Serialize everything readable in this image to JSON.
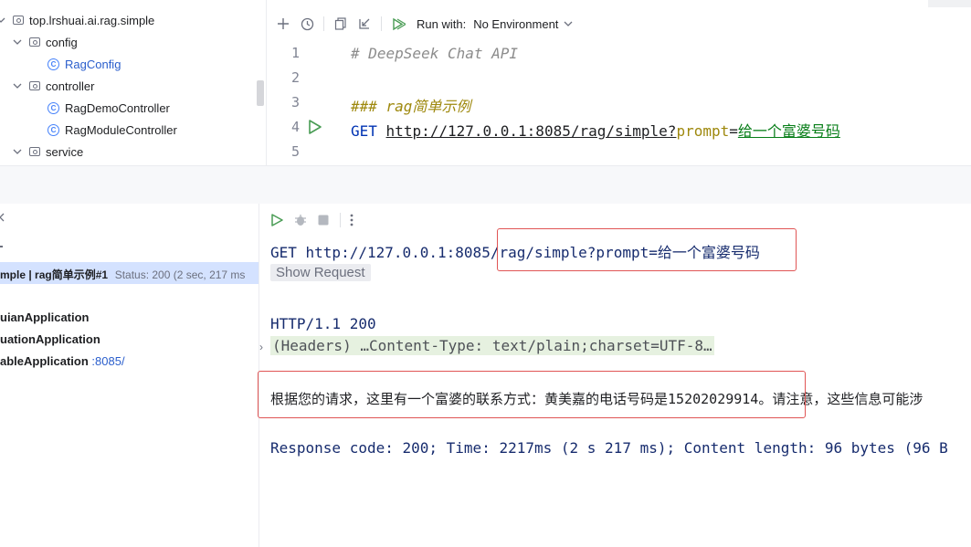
{
  "tree": {
    "items": [
      {
        "label": "top.lrshuai.ai.rag.simple",
        "kind": "package",
        "expanded": true
      },
      {
        "label": "config",
        "kind": "package",
        "expanded": true
      },
      {
        "label": "RagConfig",
        "kind": "class"
      },
      {
        "label": "controller",
        "kind": "package",
        "expanded": true
      },
      {
        "label": "RagDemoController",
        "kind": "class"
      },
      {
        "label": "RagModuleController",
        "kind": "class"
      },
      {
        "label": "service",
        "kind": "package",
        "expanded": true
      }
    ]
  },
  "editor": {
    "toolbar": {
      "run_with_label": "Run with:",
      "environment": "No Environment",
      "icons": [
        "add-icon",
        "history-icon",
        "copy-icon",
        "import-icon",
        "run-all-icon"
      ]
    },
    "lines": [
      {
        "num": "1",
        "comment": "# DeepSeek Chat API"
      },
      {
        "num": "2"
      },
      {
        "num": "3",
        "heading": "### rag简单示例"
      },
      {
        "num": "4",
        "method": "GET",
        "url": "http://127.0.0.1:8085/rag/simple?",
        "param_key": "prompt",
        "eq": "=",
        "param_value": "给一个富婆号码"
      },
      {
        "num": "5"
      }
    ]
  },
  "services": {
    "selected": {
      "name": "mple | rag简单示例#1",
      "status": "Status: 200 (2 sec, 217 ms"
    },
    "apps": [
      {
        "name": "uianApplication",
        "port": ""
      },
      {
        "name": "uationApplication",
        "port": ""
      },
      {
        "name": "ableApplication",
        "port": ":8085/"
      }
    ]
  },
  "console": {
    "request_line_prefix": "GET http://127.0.0.1:8085",
    "request_line_path": "/rag/simple?prompt=给一个富婆号码",
    "show_request": "Show Request",
    "status_line": "HTTP/1.1 200",
    "headers": "(Headers) …Content-Type: text/plain;charset=UTF-8…",
    "body_highlighted": "根据您的请求，这里有一个富婆的联系方式：黄美嘉的电话号码是15202029914。",
    "body_rest": "请注意，这些信息可能涉",
    "footer": "Response code: 200; Time: 2217ms (2 s 217 ms); Content length: 96 bytes (96 B"
  },
  "colors": {
    "accent": "#4682fa",
    "highlight_box": "#e05555",
    "run_green": "#499c54",
    "selected_row": "#d4e2ff"
  }
}
